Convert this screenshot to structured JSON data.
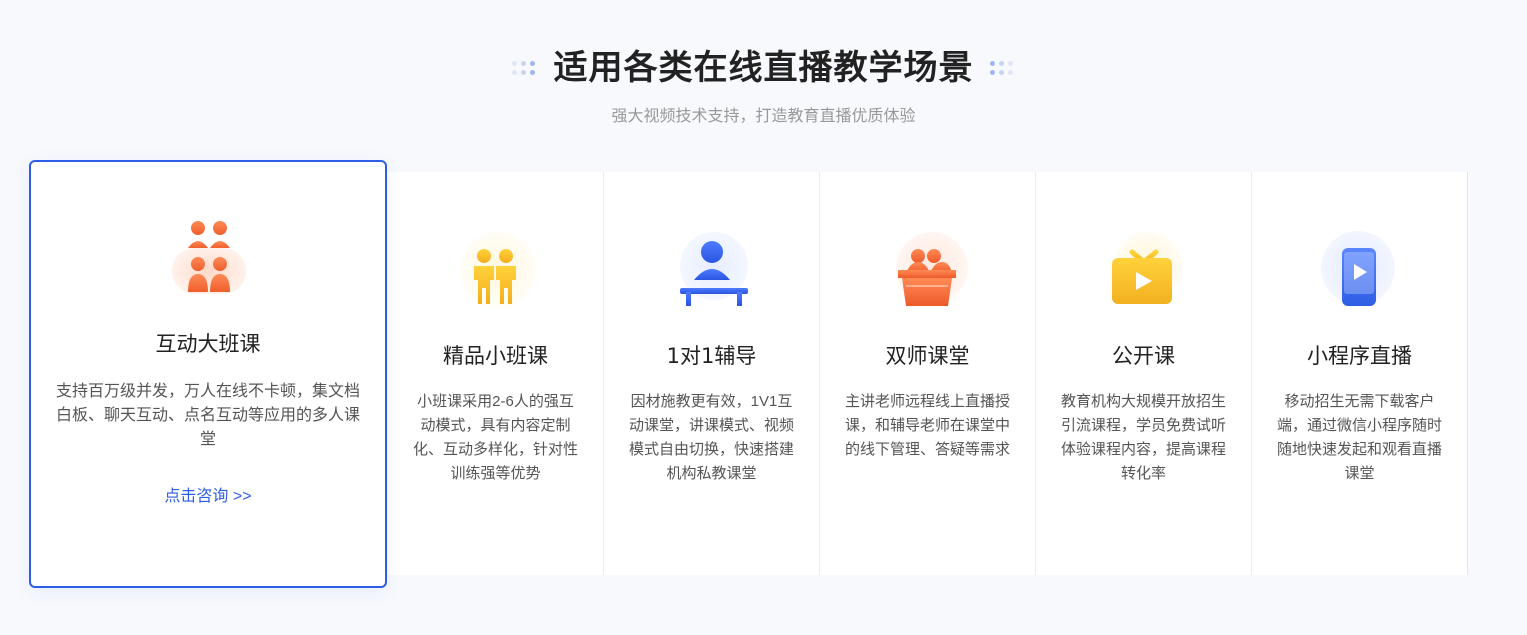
{
  "section": {
    "title": "适用各类在线直播教学场景",
    "subtitle": "强大视频技术支持，打造教育直播优质体验"
  },
  "colors": {
    "accent": "#2f5ee6",
    "orange": "#f26b3a",
    "yellow": "#f5c12e",
    "blue": "#3a6cf4"
  },
  "cards": [
    {
      "icon": "group-class-icon",
      "title": "互动大班课",
      "desc": "支持百万级并发，万人在线不卡顿，集文档白板、聊天互动、点名互动等应用的多人课堂",
      "link": "点击咨询 >>"
    },
    {
      "icon": "small-class-icon",
      "title": "精品小班课",
      "desc": "小班课采用2-6人的强互动模式，具有内容定制化、互动多样化，针对性训练强等优势"
    },
    {
      "icon": "tutor-icon",
      "title": "1对1辅导",
      "desc": "因材施教更有效，1V1互动课堂，讲课模式、视频模式自由切换，快速搭建机构私教课堂"
    },
    {
      "icon": "dual-teacher-icon",
      "title": "双师课堂",
      "desc": "主讲老师远程线上直播授课，和辅导老师在课堂中的线下管理、答疑等需求"
    },
    {
      "icon": "open-class-icon",
      "title": "公开课",
      "desc": "教育机构大规模开放招生引流课程，学员免费试听体验课程内容，提高课程转化率"
    },
    {
      "icon": "mini-program-icon",
      "title": "小程序直播",
      "desc": "移动招生无需下载客户端，通过微信小程序随时随地快速发起和观看直播课堂"
    }
  ]
}
